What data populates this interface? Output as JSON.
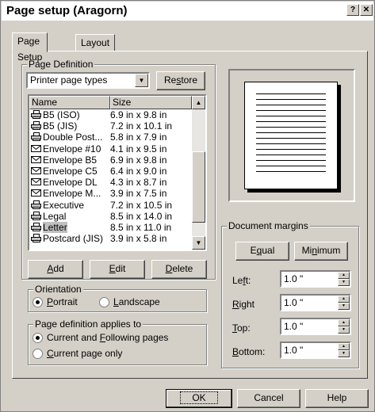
{
  "window": {
    "title": "Page setup (Aragorn)",
    "help_btn": "?",
    "close_btn": "✕"
  },
  "tabs": [
    {
      "label": "Page Setup",
      "active": true
    },
    {
      "label": "Layout",
      "active": false
    }
  ],
  "page_definition": {
    "group_label": "Page Definition",
    "type_select": "Printer page types",
    "restore_label_pre": "Re",
    "restore_label_u": "s",
    "restore_label_post": "tore",
    "columns": {
      "name": "Name",
      "size": "Size"
    },
    "rows": [
      {
        "icon": "printer-icon",
        "name": "B5 (ISO)",
        "size": "6.9 in x 9.8 in"
      },
      {
        "icon": "printer-icon",
        "name": "B5 (JIS)",
        "size": "7.2 in x 10.1 in"
      },
      {
        "icon": "printer-icon",
        "name": "Double Post...",
        "size": "5.8 in x 7.9 in"
      },
      {
        "icon": "envelope-icon",
        "name": "Envelope #10",
        "size": "4.1 in x 9.5 in"
      },
      {
        "icon": "envelope-icon",
        "name": "Envelope B5",
        "size": "6.9 in x 9.8 in"
      },
      {
        "icon": "envelope-icon",
        "name": "Envelope C5",
        "size": "6.4 in x 9.0 in"
      },
      {
        "icon": "envelope-icon",
        "name": "Envelope DL",
        "size": "4.3 in x 8.7 in"
      },
      {
        "icon": "envelope-icon",
        "name": "Envelope M...",
        "size": "3.9 in x 7.5 in"
      },
      {
        "icon": "printer-icon",
        "name": "Executive",
        "size": "7.2 in x 10.5 in"
      },
      {
        "icon": "printer-icon",
        "name": "Legal",
        "size": "8.5 in x 14.0 in"
      },
      {
        "icon": "printer-icon",
        "name": "Letter",
        "size": "8.5 in x 11.0 in",
        "selected": true
      },
      {
        "icon": "printer-icon",
        "name": "Postcard (JIS)",
        "size": "3.9 in x 5.8 in"
      }
    ],
    "add_u": "A",
    "add_rest": "dd",
    "edit_u": "E",
    "edit_rest": "dit",
    "delete_u": "D",
    "delete_rest": "elete"
  },
  "orientation": {
    "group_label": "Orientation",
    "portrait_u": "P",
    "portrait_rest": "ortrait",
    "landscape_u": "L",
    "landscape_rest": "andscape",
    "selected": "portrait"
  },
  "applies_to": {
    "group_label": "Page definition applies to",
    "opt1_pre": "Current and ",
    "opt1_u": "F",
    "opt1_post": "ollowing pages",
    "opt2_u": "C",
    "opt2_rest": "urrent page only",
    "selected": "current_and_following"
  },
  "margins": {
    "group_label": "Document margins",
    "equal_pre": "E",
    "equal_u": "q",
    "equal_post": "ual",
    "minimum_pre": "Mi",
    "minimum_u": "n",
    "minimum_post": "imum",
    "left_pre": "Le",
    "left_u": "f",
    "left_post": "t:",
    "left_value": "1.0 \"",
    "right_u": "R",
    "right_rest": "ight",
    "right_value": "1.0 \"",
    "top_u": "T",
    "top_rest": "op:",
    "top_value": "1.0 \"",
    "bottom_u": "B",
    "bottom_rest": "ottom:",
    "bottom_value": "1.0 \""
  },
  "footer": {
    "ok": "OK",
    "cancel": "Cancel",
    "help": "Help"
  }
}
